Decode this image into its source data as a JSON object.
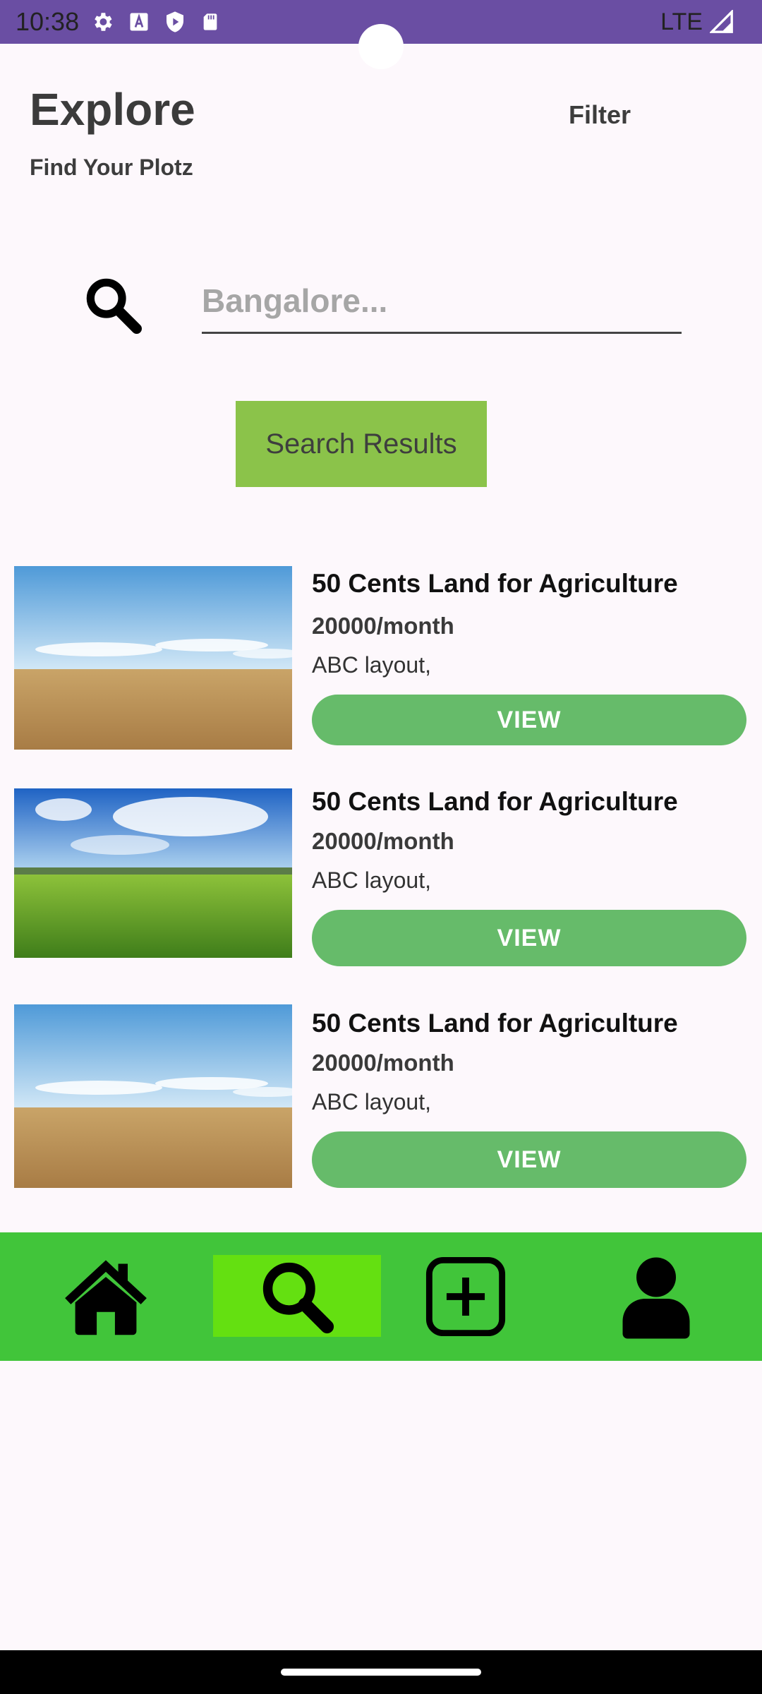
{
  "status_bar": {
    "time": "10:38",
    "network": "LTE",
    "icons": [
      "gear-icon",
      "a-icon",
      "shield-play-icon",
      "sd-card-icon",
      "signal-icon"
    ]
  },
  "header": {
    "title": "Explore",
    "subtitle": "Find Your Plotz",
    "filter_label": "Filter"
  },
  "search": {
    "placeholder": "Bangalore...",
    "value": "",
    "results_button": "Search Results"
  },
  "listings": [
    {
      "title": "50 Cents Land for Agriculture",
      "price": "20000/month",
      "location": "ABC layout,",
      "button": "VIEW",
      "image": "wheat-field-image"
    },
    {
      "title": "50 Cents Land for Agriculture",
      "price": "20000/month",
      "location": "ABC layout,",
      "button": "VIEW",
      "image": "green-meadow-image"
    },
    {
      "title": "50 Cents Land for Agriculture",
      "price": "20000/month",
      "location": "ABC layout,",
      "button": "VIEW",
      "image": "wheat-field-image"
    }
  ],
  "bottom_nav": {
    "items": [
      "home-icon",
      "search-icon",
      "add-icon",
      "profile-icon"
    ],
    "active": "search-icon"
  },
  "colors": {
    "status_bar": "#6a4ea3",
    "results_button": "#8bc34a",
    "view_button": "#66bb6a",
    "nav_bar": "#41c53a",
    "nav_active": "#64e011"
  }
}
